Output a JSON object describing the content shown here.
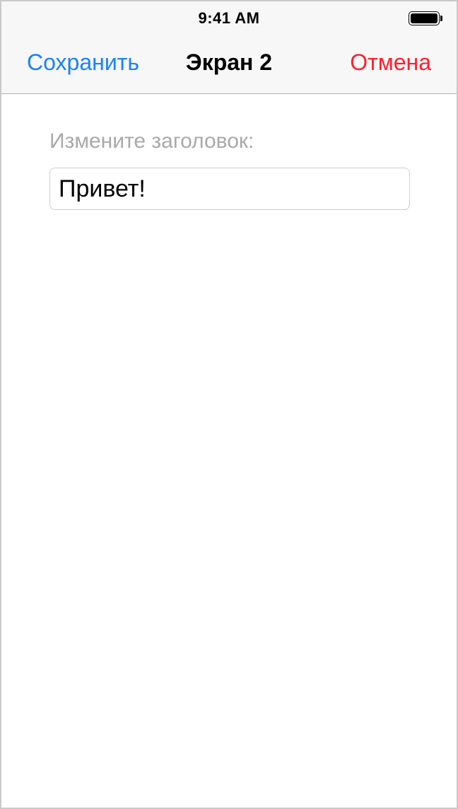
{
  "status_bar": {
    "time": "9:41 AM",
    "battery_icon": "battery-full-icon",
    "battery_level": 1.0
  },
  "nav_bar": {
    "left_button": "Сохранить",
    "title": "Экран 2",
    "right_button": "Отмена",
    "colors": {
      "left_button": "#1a82f7",
      "right_button": "#ff1e2d"
    }
  },
  "form": {
    "label": "Измените заголовок:",
    "title_value": "Привет!"
  }
}
